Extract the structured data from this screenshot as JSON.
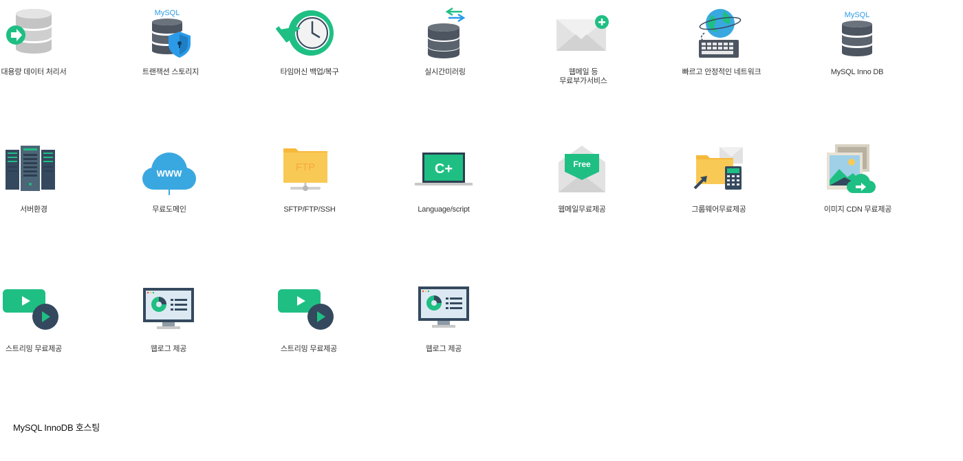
{
  "features": [
    {
      "id": "bulk-data",
      "label": "대용량 데이터 처리서",
      "icon": "database-arrow-icon"
    },
    {
      "id": "transaction-storage",
      "label": "트랜잭션 스토리지",
      "icon": "mysql-shield-database-icon",
      "icon_text": "MySQL"
    },
    {
      "id": "timemachine-backup",
      "label": "타임머신 백업/복구",
      "icon": "clock-restore-icon"
    },
    {
      "id": "realtime-mirroring",
      "label": "실시간미러링",
      "icon": "database-sync-icon"
    },
    {
      "id": "webmail-extras",
      "label": "웹메일 등\n무료부가서비스",
      "icon": "mail-plus-icon"
    },
    {
      "id": "fast-network",
      "label": "빠르고 안정적인 네트워크",
      "icon": "globe-keyboard-icon"
    },
    {
      "id": "mysql-innodb",
      "label": "MySQL Inno DB",
      "icon": "mysql-database-icon",
      "icon_text": "MySQL"
    },
    {
      "id": "server-env",
      "label": "서버환경",
      "icon": "server-rack-icon"
    },
    {
      "id": "free-domain",
      "label": "무료도메인",
      "icon": "www-cloud-icon",
      "icon_text": "WWW"
    },
    {
      "id": "sftp",
      "label": "SFTP/FTP/SSH",
      "icon": "ftp-folder-icon",
      "icon_text": "FTP"
    },
    {
      "id": "language",
      "label": "Language/script",
      "icon": "laptop-cplus-icon",
      "icon_text": "C+"
    },
    {
      "id": "free-webmail",
      "label": "웹메일무료제공",
      "icon": "free-mail-icon",
      "icon_text": "Free"
    },
    {
      "id": "free-groupware",
      "label": "그룹웨어무료제공",
      "icon": "groupware-folder-icon"
    },
    {
      "id": "image-cdn",
      "label": "이미지 CDN 무료제공",
      "icon": "image-cloud-icon"
    },
    {
      "id": "streaming-1",
      "label": "스트리밍 무료제공",
      "icon": "video-play-icon"
    },
    {
      "id": "weblog-1",
      "label": "웹로그 제공",
      "icon": "monitor-stats-icon"
    },
    {
      "id": "streaming-2",
      "label": "스트리밍 무료제공",
      "icon": "video-play-icon"
    },
    {
      "id": "weblog-2",
      "label": "웹로그 제공",
      "icon": "monitor-stats-icon"
    }
  ],
  "section_title": "MySQL InnoDB 호스팅",
  "colors": {
    "green": "#1fbf84",
    "dark_navy": "#34495e",
    "mysql_blue": "#2b9be8",
    "db_slate": "#4c5560",
    "folder_yellow": "#f9c955"
  }
}
